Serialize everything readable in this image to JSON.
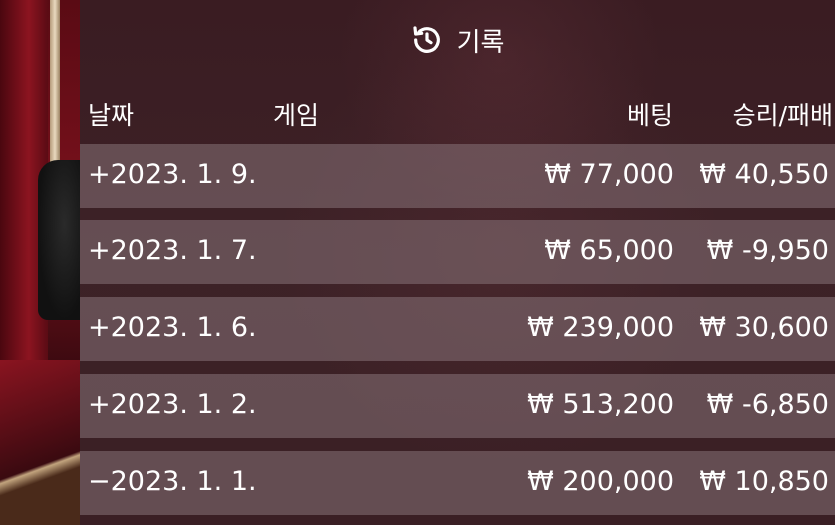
{
  "header": {
    "title": "기록",
    "icon": "history-icon"
  },
  "columns": {
    "date": "날짜",
    "game": "게임",
    "bet": "베팅",
    "result": "승리/패배"
  },
  "rows": [
    {
      "date": "+2023. 1. 9.",
      "game": "",
      "bet": "₩ 77,000",
      "result": "₩ 40,550"
    },
    {
      "date": "+2023. 1. 7.",
      "game": "",
      "bet": "₩ 65,000",
      "result": "₩ -9,950"
    },
    {
      "date": "+2023. 1. 6.",
      "game": "",
      "bet": "₩ 239,000",
      "result": "₩ 30,600"
    },
    {
      "date": "+2023. 1. 2.",
      "game": "",
      "bet": "₩ 513,200",
      "result": "₩ -6,850"
    },
    {
      "date": "−2023. 1. 1.",
      "game": "",
      "bet": "₩ 200,000",
      "result": "₩ 10,850"
    }
  ]
}
